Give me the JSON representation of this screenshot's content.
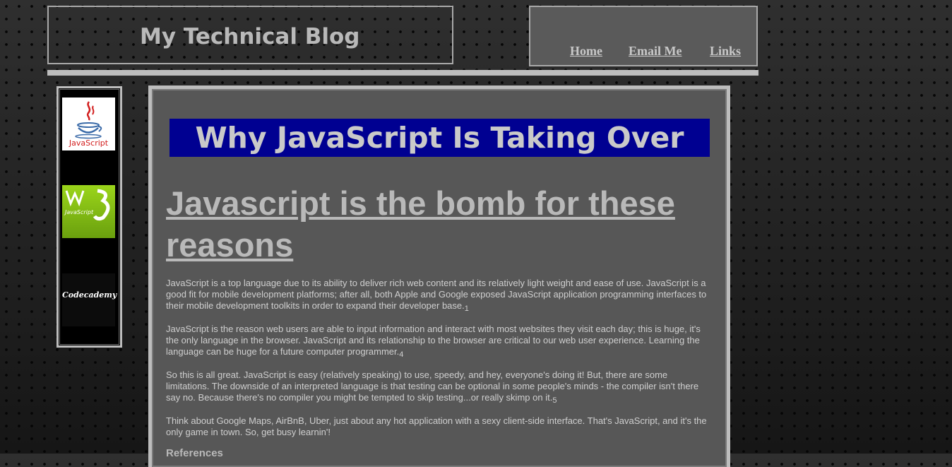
{
  "header": {
    "site_title": "My Technical Blog"
  },
  "nav": {
    "items": [
      {
        "label": "Home"
      },
      {
        "label": "Email Me"
      },
      {
        "label": "Links"
      }
    ]
  },
  "sidebar": {
    "images": [
      {
        "alt": "JavaScript",
        "icon": "javascript-logo",
        "text": "JavaScript"
      },
      {
        "alt": "W3 JavaScript",
        "icon": "w3-javascript-logo",
        "text": "JavaScript"
      },
      {
        "alt": "Codecademy",
        "icon": "codecademy-logo",
        "text": "Codecademy"
      }
    ]
  },
  "main": {
    "banner_title": "Why JavaScript Is Taking Over",
    "post_heading": "Javascript is the bomb for these reasons",
    "paragraphs": [
      {
        "text": "JavaScript is a top language due to its ability to deliver rich web content and its relatively light weight and ease of use. JavaScript is a good fit for mobile development platforms; after all, both Apple and Google exposed JavaScript application programming interfaces to their mobile development toolkits in order to expand their developer base.",
        "ref": "1"
      },
      {
        "text": "JavaScript is the reason web users are able to input information and interact with most websites they visit each day; this is huge, it's the only language in the browser. JavaScript and its relationship to the browser are critical to our web user experience. Learning the language can be huge for a future computer programmer.",
        "ref": "4"
      },
      {
        "text": "So this is all great. JavaScript is easy (relatively speaking) to use, speedy, and hey, everyone's doing it! But, there are some limitations. The downside of an interpreted language is that testing can be optional in some people's minds - the compiler isn't there say no. Because there's no compiler you might be tempted to skip testing...or really skimp on it.",
        "ref": "5"
      },
      {
        "text": "Think about Google Maps, AirBnB, Uber, just about any hot application with a sexy client-side interface. That's JavaScript, and it's the only game in town. So, get busy learnin'!",
        "ref": ""
      }
    ],
    "references_heading": "References"
  },
  "colors": {
    "banner_bg": "#000091",
    "panel_bg": "#575757",
    "border": "#bdbdbd",
    "text": "#cfcfcf"
  }
}
